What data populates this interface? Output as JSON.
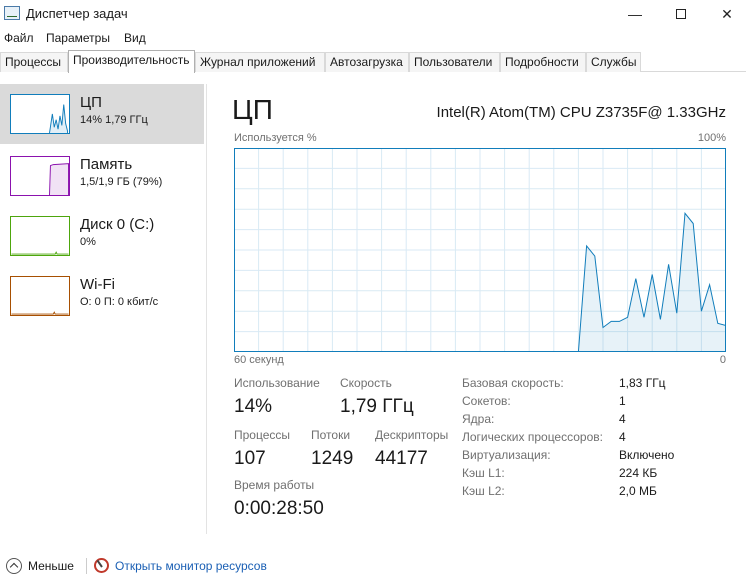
{
  "window": {
    "title": "Диспетчер задач"
  },
  "menu": [
    "Файл",
    "Параметры",
    "Вид"
  ],
  "tabs": [
    "Процессы",
    "Производительность",
    "Журнал приложений",
    "Автозагрузка",
    "Пользователи",
    "Подробности",
    "Службы"
  ],
  "active_tab": "Производительность",
  "sidebar": [
    {
      "name": "ЦП",
      "detail": "14%  1,79 ГГц",
      "color": "#117dbb",
      "selected": true
    },
    {
      "name": "Память",
      "detail": "1,5/1,9 ГБ (79%)",
      "color": "#8b12ae",
      "selected": false
    },
    {
      "name": "Диск 0 (C:)",
      "detail": "0%",
      "color": "#4da60c",
      "selected": false
    },
    {
      "name": "Wi-Fi",
      "detail": "О: 0 П: 0 кбит/с",
      "color": "#a74f01",
      "selected": false
    }
  ],
  "main": {
    "title": "ЦП",
    "model": "Intel(R) Atom(TM) CPU Z3735F@ 1.33GHz",
    "chart_top_left": "Используется %",
    "chart_top_right": "100%",
    "chart_bottom_left": "60 секунд",
    "chart_bottom_right": "0"
  },
  "chart_data": {
    "type": "area",
    "title": "",
    "xlabel": "60 секунд",
    "ylabel": "Используется %",
    "xlim": [
      60,
      0
    ],
    "ylim": [
      0,
      100
    ],
    "grid": true,
    "color": "#117dbb",
    "series": [
      {
        "x": [
          60,
          59,
          58,
          57,
          56,
          55,
          54,
          53,
          52,
          51,
          50,
          49,
          48,
          47,
          46,
          45,
          44,
          43,
          42,
          41,
          40,
          39,
          38,
          37,
          36,
          35,
          34,
          33,
          32,
          31,
          30,
          29,
          28,
          27,
          26,
          25,
          24,
          23,
          22,
          21,
          20,
          19,
          18,
          17,
          16,
          15,
          14,
          13,
          12,
          11,
          10,
          9,
          8,
          7,
          6,
          5,
          4,
          3,
          2,
          1,
          0
        ],
        "values": [
          0,
          0,
          0,
          0,
          0,
          0,
          0,
          0,
          0,
          0,
          0,
          0,
          0,
          0,
          0,
          0,
          0,
          0,
          0,
          0,
          0,
          0,
          0,
          0,
          0,
          0,
          0,
          0,
          0,
          0,
          0,
          0,
          0,
          0,
          0,
          0,
          0,
          0,
          0,
          0,
          0,
          0,
          0,
          52,
          47,
          12,
          15,
          15,
          17,
          36,
          17,
          38,
          16,
          43,
          19,
          68,
          63,
          20,
          33,
          14,
          13
        ]
      }
    ]
  },
  "stats": {
    "usage_label": "Использование",
    "usage": "14%",
    "speed_label": "Скорость",
    "speed": "1,79 ГГц",
    "processes_label": "Процессы",
    "processes": "107",
    "threads_label": "Потоки",
    "threads": "1249",
    "handles_label": "Дескрипторы",
    "handles": "44177",
    "uptime_label": "Время работы",
    "uptime": "0:00:28:50"
  },
  "info": [
    {
      "key": "Базовая скорость:",
      "value": "1,83 ГГц"
    },
    {
      "key": "Сокетов:",
      "value": "1"
    },
    {
      "key": "Ядра:",
      "value": "4"
    },
    {
      "key": "Логических процессоров:",
      "value": "4"
    },
    {
      "key": "Виртуализация:",
      "value": "Включено"
    },
    {
      "key": "Кэш L1:",
      "value": "224 КБ"
    },
    {
      "key": "Кэш L2:",
      "value": "2,0 МБ"
    }
  ],
  "footer": {
    "less_label": "Меньше",
    "monitor_link": "Открыть монитор ресурсов"
  }
}
